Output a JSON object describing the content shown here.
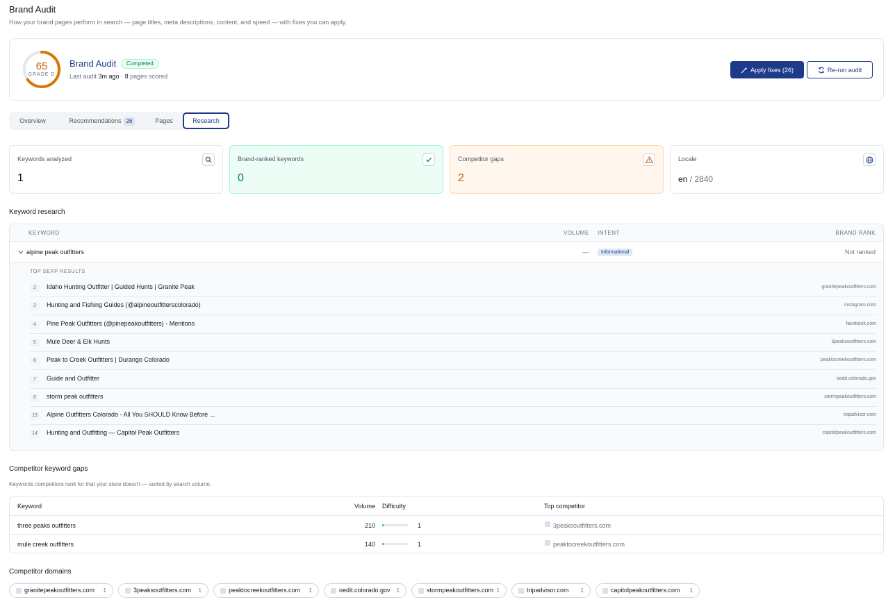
{
  "page": {
    "title": "Brand Audit",
    "subtitle": "How your brand pages perform in search — page titles, meta descriptions, content, and speed — with fixes you can apply."
  },
  "summary": {
    "score": "65",
    "score_fraction": 0.65,
    "grade": "GRADE D",
    "name": "Brand Audit",
    "status": "Completed",
    "last_audit_label": "Last audit",
    "last_audit_ago": "3m ago",
    "separator": "·",
    "pages_count": "8",
    "pages_label": "pages scored",
    "apply_fixes": "Apply fixes (26)",
    "rerun": "Re-run audit",
    "colors": {
      "score_ring": "#d97706",
      "primary": "#1e3a8a",
      "status": "#047857"
    }
  },
  "tabs": [
    {
      "label": "Overview"
    },
    {
      "label": "Recommendations",
      "badge": "26"
    },
    {
      "label": "Pages"
    },
    {
      "label": "Research",
      "active": true
    }
  ],
  "stats": [
    {
      "label": "Keywords analyzed",
      "value": "1",
      "icon": "search-icon"
    },
    {
      "label": "Brand-ranked keywords",
      "value": "0",
      "icon": "check-icon"
    },
    {
      "label": "Competitor gaps",
      "value": "2",
      "icon": "warning-icon"
    },
    {
      "label": "Locale",
      "value": "en",
      "value_suffix": "/ 2840",
      "icon": "globe-icon"
    }
  ],
  "keyword_research": {
    "title": "Keyword research",
    "headers": {
      "keyword": "KEYWORD",
      "volume": "VOLUME",
      "intent": "INTENT",
      "brand_rank": "BRAND RANK"
    },
    "row": {
      "keyword": "alpine peak outfitters",
      "volume": "—",
      "intent": "Informational",
      "brand_rank": "Not ranked"
    },
    "serp_heading": "TOP SERP RESULTS",
    "serp": [
      {
        "rank": "2",
        "title": "Idaho Hunting Outfitter | Guided Hunts | Granite Peak",
        "domain": "granitepeakoutfitters.com"
      },
      {
        "rank": "3",
        "title": "Hunting and Fishing Guides (@alpineoutfitterscolorado)",
        "domain": "instagram.com"
      },
      {
        "rank": "4",
        "title": "Pine Peak Outfitters (@pinepeakoutfitters) - Mentions",
        "domain": "facebook.com"
      },
      {
        "rank": "5",
        "title": "Mule Deer & Elk Hunts",
        "domain": "3peaksoutfitters.com"
      },
      {
        "rank": "6",
        "title": "Peak to Creek Outfitters | Durango Colorado",
        "domain": "peaktocreekoutfitters.com"
      },
      {
        "rank": "7",
        "title": "Guide and Outfitter",
        "domain": "oedit.colorado.gov"
      },
      {
        "rank": "8",
        "title": "storm peak outfitters",
        "domain": "stormpeakoutfitters.com"
      },
      {
        "rank": "13",
        "title": "Alpine Outfitters Colorado - All You SHOULD Know Before ...",
        "domain": "tripadvisor.com"
      },
      {
        "rank": "14",
        "title": "Hunting and Outfitting — Capitol Peak Outfitters",
        "domain": "capitolpeakoutfitters.com"
      }
    ]
  },
  "competitor_gaps": {
    "title": "Competitor keyword gaps",
    "subtitle": "Keywords competitors rank for that your store doesn't — sorted by search volume.",
    "headers": {
      "keyword": "Keyword",
      "volume": "Volume",
      "difficulty": "Difficulty",
      "top_competitor": "Top competitor"
    },
    "rows": [
      {
        "keyword": "three peaks outfitters",
        "volume": "210",
        "difficulty": "1",
        "difficulty_fraction": 0.01,
        "competitor": "3peaksoutfitters.com"
      },
      {
        "keyword": "mule creek outfitters",
        "volume": "140",
        "difficulty": "1",
        "difficulty_fraction": 0.01,
        "competitor": "peaktocreekoutfitters.com"
      }
    ]
  },
  "competitor_domains": {
    "title": "Competitor domains",
    "items": [
      {
        "domain": "granitepeakoutfitters.com",
        "count": "1"
      },
      {
        "domain": "3peaksoutfitters.com",
        "count": "1"
      },
      {
        "domain": "peaktocreekoutfitters.com",
        "count": "1"
      },
      {
        "domain": "oedit.colorado.gov",
        "count": "1"
      },
      {
        "domain": "stormpeakoutfitters.com",
        "count": "1"
      },
      {
        "domain": "tripadvisor.com",
        "count": "1"
      },
      {
        "domain": "capitolpeakoutfitters.com",
        "count": "1"
      }
    ]
  }
}
